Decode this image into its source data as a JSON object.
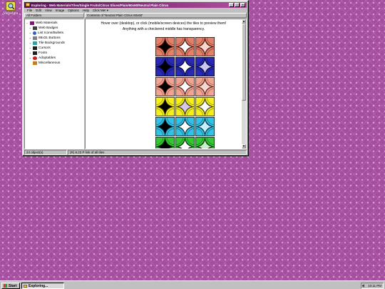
{
  "desktop": {
    "icon_label": "Metadata",
    "icon": "magnifier-icon"
  },
  "window": {
    "title": "Exploring - Web Materials/Tiles/Single Fruits/Citrus Slices/Plain/60x60/Neutral Plain Citrus",
    "buttons": {
      "minimize": "_",
      "maximize": "□",
      "close": "×"
    },
    "menu": [
      "File",
      "Edit",
      "View",
      "Image",
      "Options",
      "Help",
      "Click Me! ▾"
    ],
    "left_header": "All Folders",
    "right_header": "Contents of 'Neutral Plain Citrus 60x60'",
    "tree": [
      {
        "label": "Web Materials",
        "expander": "−",
        "icon": "folder-icon",
        "color": "#7a1a70",
        "child": false
      },
      {
        "label": "Web Badges",
        "expander": "+",
        "icon": "badge-icon",
        "color": "#404040",
        "child": true
      },
      {
        "label": "List Icons/Bullets",
        "expander": "+",
        "icon": "bullet-icon",
        "color": "#3060c0",
        "child": true
      },
      {
        "label": "88x31 Buttons",
        "expander": "+",
        "icon": "button-icon",
        "color": "#808080",
        "child": true
      },
      {
        "label": "Tile Backgrounds",
        "expander": "+",
        "icon": "tile-icon",
        "color": "#30a0a0",
        "child": true
      },
      {
        "label": "Cursors",
        "expander": "+",
        "icon": "cursor-icon",
        "color": "#202020",
        "child": true
      },
      {
        "label": "Fonts",
        "expander": "+",
        "icon": "font-icon",
        "color": "#202020",
        "child": true
      },
      {
        "label": "Adoptables",
        "expander": "+",
        "icon": "heart-icon",
        "color": "#d02020",
        "child": true
      },
      {
        "label": "Miscellaneous",
        "expander": "",
        "icon": "folder-icon",
        "color": "#c08020",
        "child": true
      }
    ],
    "info_line1": "Hover over (desktop), or click (mobile/screen devices) the tiles to preview them!",
    "info_line2": "Anything with a checkered middle has transparency.",
    "tile_rows": [
      {
        "bg": "#e2806a",
        "stroke": "#7a2a1a",
        "centers": [
          "#000000",
          "#ffffff",
          "#fbd6cc"
        ]
      },
      {
        "bg": "#2a2ab8",
        "stroke": "#0a0a60",
        "centers": [
          "#000000",
          "#ffffff",
          "#c8c8f0"
        ]
      },
      {
        "bg": "#f2a494",
        "stroke": "#9a4a3a",
        "centers": [
          "#000000",
          "#ffffff",
          "#fbd8cf"
        ]
      },
      {
        "bg": "#f4f018",
        "stroke": "#7a7208",
        "centers": [
          "#000000",
          "#d8c8e8",
          "#ffffff"
        ]
      },
      {
        "bg": "#32c2e6",
        "stroke": "#0a5a70",
        "centers": [
          "#000000",
          "#ffffff",
          "#c8f0ff"
        ]
      },
      {
        "bg": "#33c833",
        "stroke": "#0a600a",
        "centers": [
          "#000000",
          "#ffffff",
          "#c8f0c8"
        ]
      }
    ],
    "status_left": "24 object(s)",
    "status_right": "(R) 8.23 P link of all tiles"
  },
  "taskbar": {
    "start_label": "Start",
    "task_label": "Exploring...",
    "clock": "10:11 PM",
    "tray_icon": "speaker-icon"
  }
}
